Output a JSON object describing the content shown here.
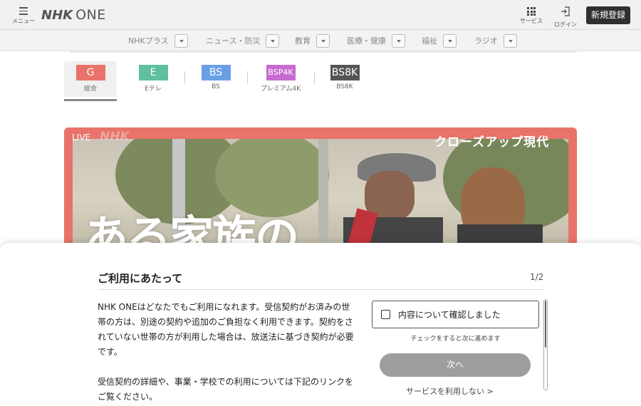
{
  "header": {
    "menu_label": "メニュー",
    "logo_nhk": "NHK",
    "logo_one": "ONE",
    "services_label": "サービス",
    "login_label": "ログイン",
    "signup_label": "新規登録"
  },
  "categories": [
    {
      "label": "NHKプラス"
    },
    {
      "label": "ニュース・防災"
    },
    {
      "label": "教育"
    },
    {
      "label": "医療・健康"
    },
    {
      "label": "福祉"
    },
    {
      "label": "ラジオ"
    }
  ],
  "channels": [
    {
      "code": "G",
      "label": "総合",
      "color": "#e8736a",
      "active": true
    },
    {
      "code": "E",
      "label": "Eテレ",
      "color": "#5fbfa0"
    },
    {
      "code": "BS",
      "label": "BS",
      "color": "#6a9fe6"
    },
    {
      "code": "BSP4K",
      "label": "プレミアム4K",
      "color": "#c86bd0"
    },
    {
      "code": "BS8K",
      "label": "BS8K",
      "color": "#555555"
    }
  ],
  "hero": {
    "live_label": "LIVE",
    "watermark": "NHK",
    "program_title": "クローズアップ現代",
    "headline": "ある家族の"
  },
  "modal": {
    "title": "ご利用にあたって",
    "page_indicator": "1/2",
    "paragraph1": "NHK ONEはどなたでもご利用になれます。受信契約がお済みの世帯の方は、別途の契約や追加のご負担なく利用できます。契約をされていない世帯の方が利用した場合は、放送法に基づき契約が必要です。",
    "paragraph2": "受信契約の詳細や、事業・学校での利用については下記のリンクをご覧ください。",
    "confirm_label": "内容について確認しました",
    "hint": "チェックをすると次に進めます",
    "next_label": "次へ",
    "service_link": "サービスを利用しない >"
  }
}
